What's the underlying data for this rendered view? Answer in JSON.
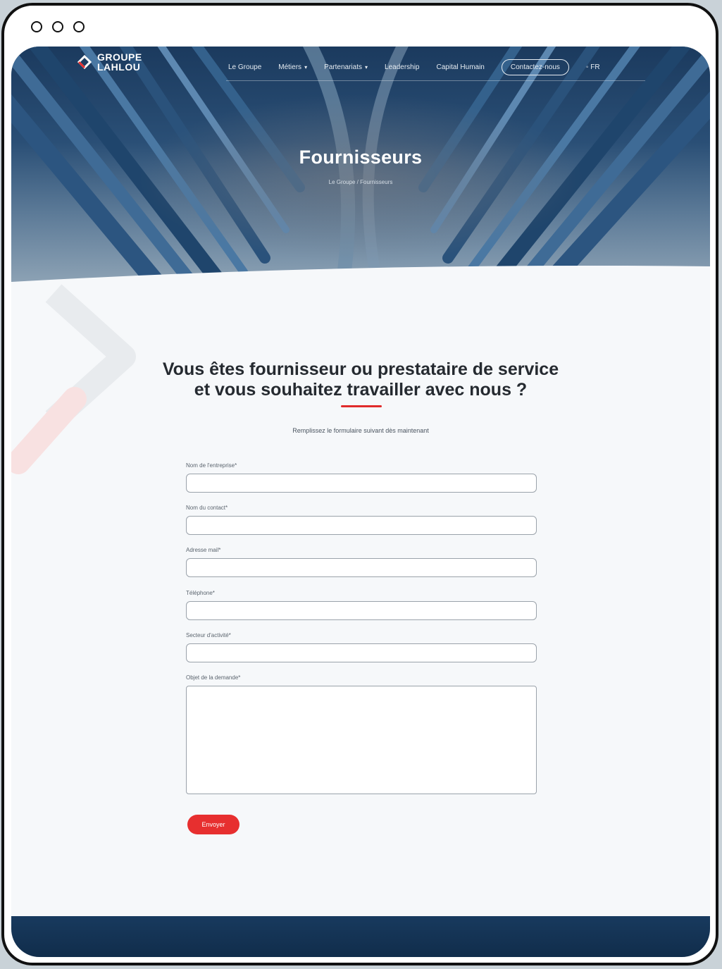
{
  "brand": {
    "line1": "GROUPE",
    "line2": "LAHLOU"
  },
  "nav": {
    "items": [
      {
        "label": "Le Groupe",
        "has_dropdown": false
      },
      {
        "label": "Métiers",
        "has_dropdown": true
      },
      {
        "label": "Partenariats",
        "has_dropdown": true
      },
      {
        "label": "Leadership",
        "has_dropdown": false
      },
      {
        "label": "Capital Humain",
        "has_dropdown": false
      }
    ],
    "contact_label": "Contactez-nous",
    "language": "FR"
  },
  "hero": {
    "title": "Fournisseurs",
    "breadcrumb": "Le Groupe / Fournisseurs"
  },
  "content": {
    "heading_line1": "Vous êtes fournisseur ou prestataire de service",
    "heading_line2": "et vous souhaitez travailler avec nous ?",
    "intro": "Remplissez le formulaire suivant dès maintenant"
  },
  "form": {
    "fields": [
      {
        "label": "Nom de l'entreprise*",
        "value": ""
      },
      {
        "label": "Nom du contact*",
        "value": ""
      },
      {
        "label": "Adresse mail*",
        "value": ""
      },
      {
        "label": "Téléphone*",
        "value": ""
      },
      {
        "label": "Secteur d'activité*",
        "value": ""
      },
      {
        "label": "Objet de la demande*",
        "value": ""
      }
    ],
    "submit_label": "Envoyer"
  },
  "colors": {
    "accent": "#e72f2f",
    "hero_dark": "#1b3a5e",
    "footer": "#0f2a47",
    "heading": "#252a30"
  }
}
